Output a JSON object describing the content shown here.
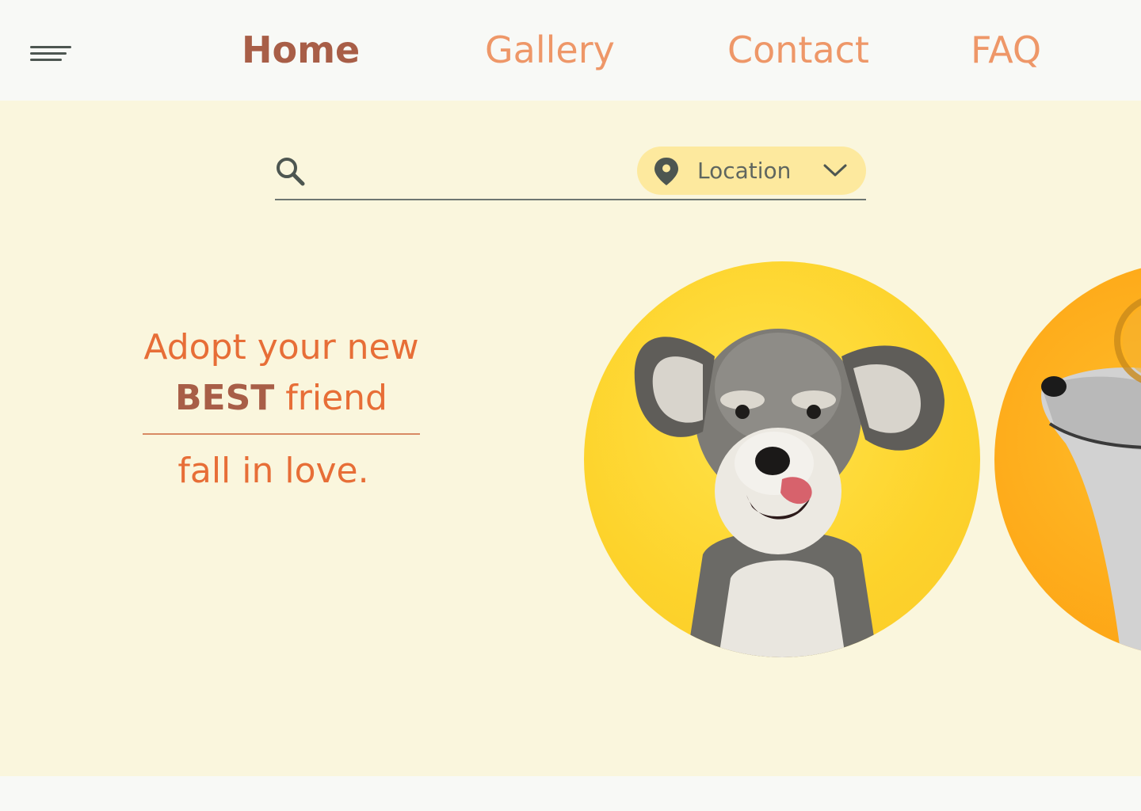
{
  "nav": {
    "menu_icon": "hamburger-menu-icon",
    "links": [
      {
        "label": "Home",
        "active": true
      },
      {
        "label": "Gallery",
        "active": false
      },
      {
        "label": "Contact",
        "active": false
      },
      {
        "label": "FAQ",
        "active": false
      }
    ]
  },
  "search": {
    "placeholder": "",
    "value": "",
    "icon": "search-icon",
    "location": {
      "label": "Location",
      "icon": "location-pin-icon",
      "dropdown_icon": "chevron-down-icon"
    }
  },
  "hero": {
    "tagline_part1": "Adopt your new",
    "tagline_best": "BEST",
    "tagline_part2": "friend",
    "tagline_part3": "fall in love."
  },
  "colors": {
    "nav_link": "#ee9768",
    "nav_active": "#a85e47",
    "hero_bg": "#faf6dd",
    "location_pill": "#fde99e",
    "tagline": "#e76e37",
    "header_bg": "#f8f9f6"
  }
}
